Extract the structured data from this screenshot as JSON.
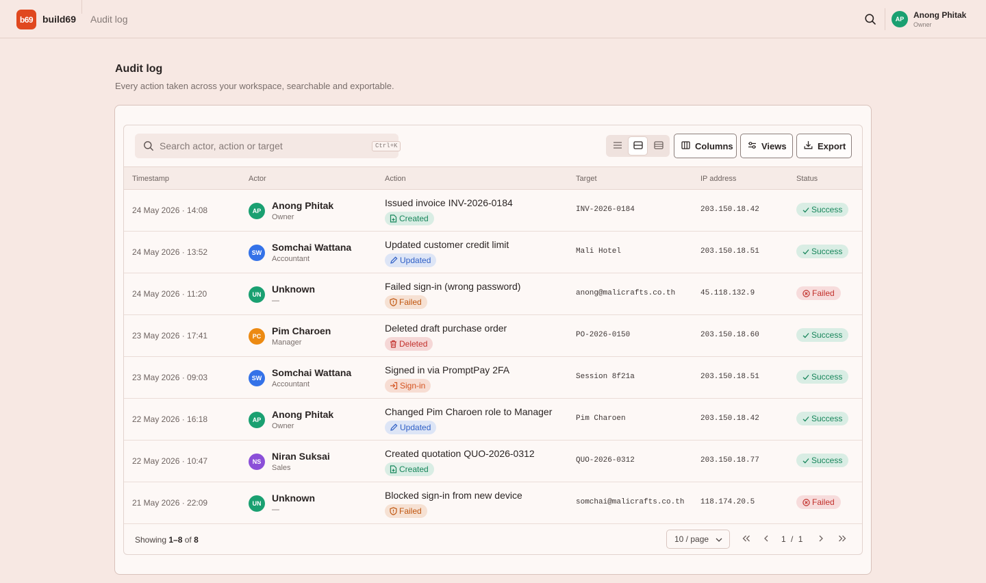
{
  "app": {
    "logo_text": "b69",
    "brand": "build69",
    "breadcrumb": "Audit log"
  },
  "user": {
    "initials": "AP",
    "name": "Anong Phitak",
    "role": "Owner"
  },
  "page": {
    "title": "Audit log",
    "subtitle": "Every action taken across your workspace, searchable and exportable."
  },
  "toolbar": {
    "search_placeholder": "Search actor, action or target",
    "search_shortcut": "Ctrl+K",
    "density_options": [
      "compact",
      "comfortable",
      "spacious"
    ],
    "density_selected": "comfortable",
    "columns_label": "Columns",
    "views_label": "Views",
    "export_label": "Export"
  },
  "table": {
    "headers": [
      "Timestamp",
      "Actor",
      "Action",
      "Target",
      "IP address",
      "Status"
    ],
    "rows": [
      {
        "timestamp": "24 May 2026 · 14:08",
        "initials": "AP",
        "avatar_color": "#1aa071",
        "actor": "Anong Phitak",
        "role": "Owner",
        "action": "Issued invoice INV-2026-0184",
        "chip": "Created",
        "target": "INV-2026-0184",
        "ip": "203.150.18.42",
        "status": "Success"
      },
      {
        "timestamp": "24 May 2026 · 13:52",
        "initials": "SW",
        "avatar_color": "#3472e8",
        "actor": "Somchai Wattana",
        "role": "Accountant",
        "action": "Updated customer credit limit",
        "chip": "Updated",
        "target": "Mali Hotel",
        "ip": "203.150.18.51",
        "status": "Success"
      },
      {
        "timestamp": "24 May 2026 · 11:20",
        "initials": "UN",
        "avatar_color": "#1aa071",
        "actor": "Unknown",
        "role": "—",
        "action": "Failed sign-in (wrong password)",
        "chip": "Failed",
        "target": "anong@malicrafts.co.th",
        "ip": "45.118.132.9",
        "status": "Failed"
      },
      {
        "timestamp": "23 May 2026 · 17:41",
        "initials": "PC",
        "avatar_color": "#ec8a12",
        "actor": "Pim Charoen",
        "role": "Manager",
        "action": "Deleted draft purchase order",
        "chip": "Deleted",
        "target": "PO-2026-0150",
        "ip": "203.150.18.60",
        "status": "Success"
      },
      {
        "timestamp": "23 May 2026 · 09:03",
        "initials": "SW",
        "avatar_color": "#3472e8",
        "actor": "Somchai Wattana",
        "role": "Accountant",
        "action": "Signed in via PromptPay 2FA",
        "chip": "Sign-in",
        "target": "Session 8f21a",
        "ip": "203.150.18.51",
        "status": "Success"
      },
      {
        "timestamp": "22 May 2026 · 16:18",
        "initials": "AP",
        "avatar_color": "#1aa071",
        "actor": "Anong Phitak",
        "role": "Owner",
        "action": "Changed Pim Charoen role to Manager",
        "chip": "Updated",
        "target": "Pim Charoen",
        "ip": "203.150.18.42",
        "status": "Success"
      },
      {
        "timestamp": "22 May 2026 · 10:47",
        "initials": "NS",
        "avatar_color": "#8b4fd8",
        "actor": "Niran Suksai",
        "role": "Sales",
        "action": "Created quotation QUO-2026-0312",
        "chip": "Created",
        "target": "QUO-2026-0312",
        "ip": "203.150.18.77",
        "status": "Success"
      },
      {
        "timestamp": "21 May 2026 · 22:09",
        "initials": "UN",
        "avatar_color": "#1aa071",
        "actor": "Unknown",
        "role": "—",
        "action": "Blocked sign-in from new device",
        "chip": "Failed",
        "target": "somchai@malicrafts.co.th",
        "ip": "118.174.20.5",
        "status": "Failed"
      }
    ]
  },
  "chip_styles": {
    "Created": {
      "bg": "#d9ede4",
      "fg": "#17855a",
      "icon": "doc-plus-icon"
    },
    "Updated": {
      "bg": "#dde5f6",
      "fg": "#2f5fc6",
      "icon": "pencil-icon"
    },
    "Failed": {
      "bg": "#f6e1d3",
      "fg": "#c0560f",
      "icon": "shield-alert-icon"
    },
    "Deleted": {
      "bg": "#f5d7d6",
      "fg": "#c2302b",
      "icon": "trash-icon"
    },
    "Sign-in": {
      "bg": "#f7ddd3",
      "fg": "#d4521f",
      "icon": "sign-in-icon"
    }
  },
  "status_styles": {
    "Success": {
      "bg": "#d9ede4",
      "fg": "#17855a",
      "icon": "check-icon"
    },
    "Failed": {
      "bg": "#f7dcdc",
      "fg": "#c2302b",
      "icon": "x-circle-icon"
    }
  },
  "footer": {
    "showing_prefix": "Showing",
    "showing_range": "1–8",
    "showing_of": "of",
    "showing_total": "8",
    "per_page": "10 / page",
    "current_page": "1",
    "page_sep": "/",
    "total_pages": "1"
  }
}
